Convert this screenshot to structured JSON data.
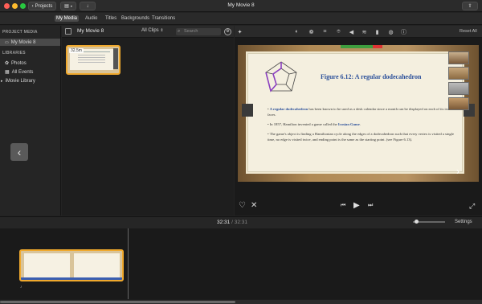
{
  "window": {
    "title": "My Movie 8",
    "projects_label": "Projects"
  },
  "tabs": [
    {
      "label": "My Media",
      "active": true
    },
    {
      "label": "Audio",
      "active": false
    },
    {
      "label": "Titles",
      "active": false
    },
    {
      "label": "Backgrounds",
      "active": false
    },
    {
      "label": "Transitions",
      "active": false
    }
  ],
  "sidebar": {
    "project_media_header": "PROJECT MEDIA",
    "project_item": "My Movie 8",
    "libraries_header": "LIBRARIES",
    "library_items": [
      "Photos",
      "All Events",
      "iMovie Library"
    ]
  },
  "browser": {
    "title": "My Movie 8",
    "filter": "All Clips",
    "search_placeholder": "Search",
    "clip_duration": "32.5m"
  },
  "viewer": {
    "reset_all": "Reset All"
  },
  "slide": {
    "title": "Figure 6.12: A regular dodecahedron",
    "bullet1_link": "A regular dodecahedron",
    "bullet1_rest": " has been known to be used as a desk calendar since a month can be displayed on each of its twelve faces.",
    "bullet2_prefix": "In 1857, Hamilton invented a game called the ",
    "bullet2_link": "Icosian Game",
    "bullet2_suffix": ".",
    "bullet3": "The game's object is finding a Hamiltonian cycle along the edges of a dodecahedron such that every vertex is visited a single time, no edge is visited twice, and ending point is the same as the starting point. (see Figure 6.13)."
  },
  "timeline": {
    "current": "32:31",
    "separator": "/",
    "total": "32:31",
    "settings_label": "Settings"
  },
  "colors": {
    "accent_selection": "#f0a92d",
    "slide_title_blue": "#2a4f9a",
    "slide_background": "#f4efdf"
  }
}
